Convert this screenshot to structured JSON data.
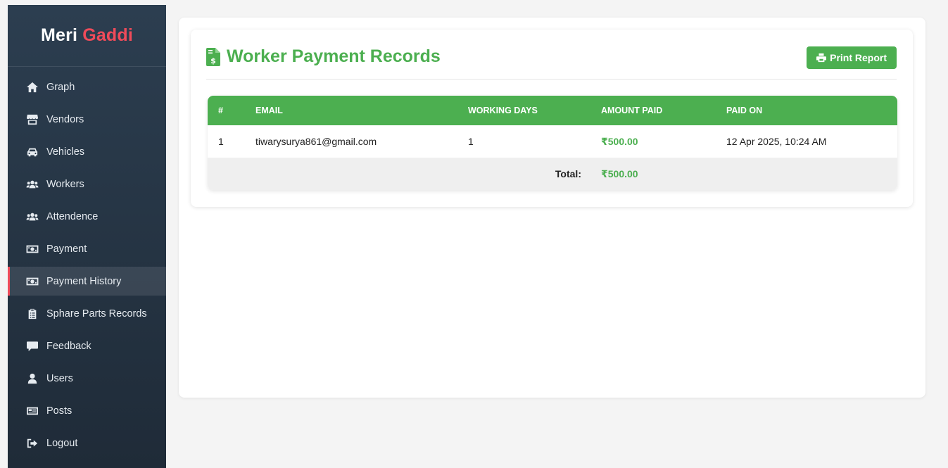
{
  "brand": {
    "primary": "Meri",
    "accent": "Gaddi",
    "accent_color": "#ef4b5a"
  },
  "sidebar": {
    "items": [
      {
        "label": "Graph",
        "icon": "home-icon",
        "active": false
      },
      {
        "label": "Vendors",
        "icon": "store-icon",
        "active": false
      },
      {
        "label": "Vehicles",
        "icon": "car-icon",
        "active": false
      },
      {
        "label": "Workers",
        "icon": "users-icon",
        "active": false
      },
      {
        "label": "Attendence",
        "icon": "users-icon",
        "active": false
      },
      {
        "label": "Payment",
        "icon": "money-bill-icon",
        "active": false
      },
      {
        "label": "Payment History",
        "icon": "money-bill-icon",
        "active": true
      },
      {
        "label": "Sphare Parts Records",
        "icon": "clipboard-icon",
        "active": false
      },
      {
        "label": "Feedback",
        "icon": "comment-icon",
        "active": false
      },
      {
        "label": "Users",
        "icon": "user-icon",
        "active": false
      },
      {
        "label": "Posts",
        "icon": "newspaper-icon",
        "active": false
      },
      {
        "label": "Logout",
        "icon": "sign-out-icon",
        "active": false
      }
    ]
  },
  "main": {
    "title": "Worker Payment Records",
    "title_icon": "file-invoice-dollar-icon",
    "accent_color": "#4caf50",
    "print_button": {
      "label": "Print Report",
      "icon": "print-icon"
    },
    "table": {
      "headers": [
        "#",
        "EMAIL",
        "WORKING DAYS",
        "AMOUNT PAID",
        "PAID ON"
      ],
      "rows": [
        {
          "index": "1",
          "email": "tiwarysurya861@gmail.com",
          "working_days": "1",
          "amount": "₹500.00",
          "paid_on": "12 Apr 2025, 10:24 AM"
        }
      ],
      "total_label": "Total:",
      "total_amount": "₹500.00"
    }
  }
}
